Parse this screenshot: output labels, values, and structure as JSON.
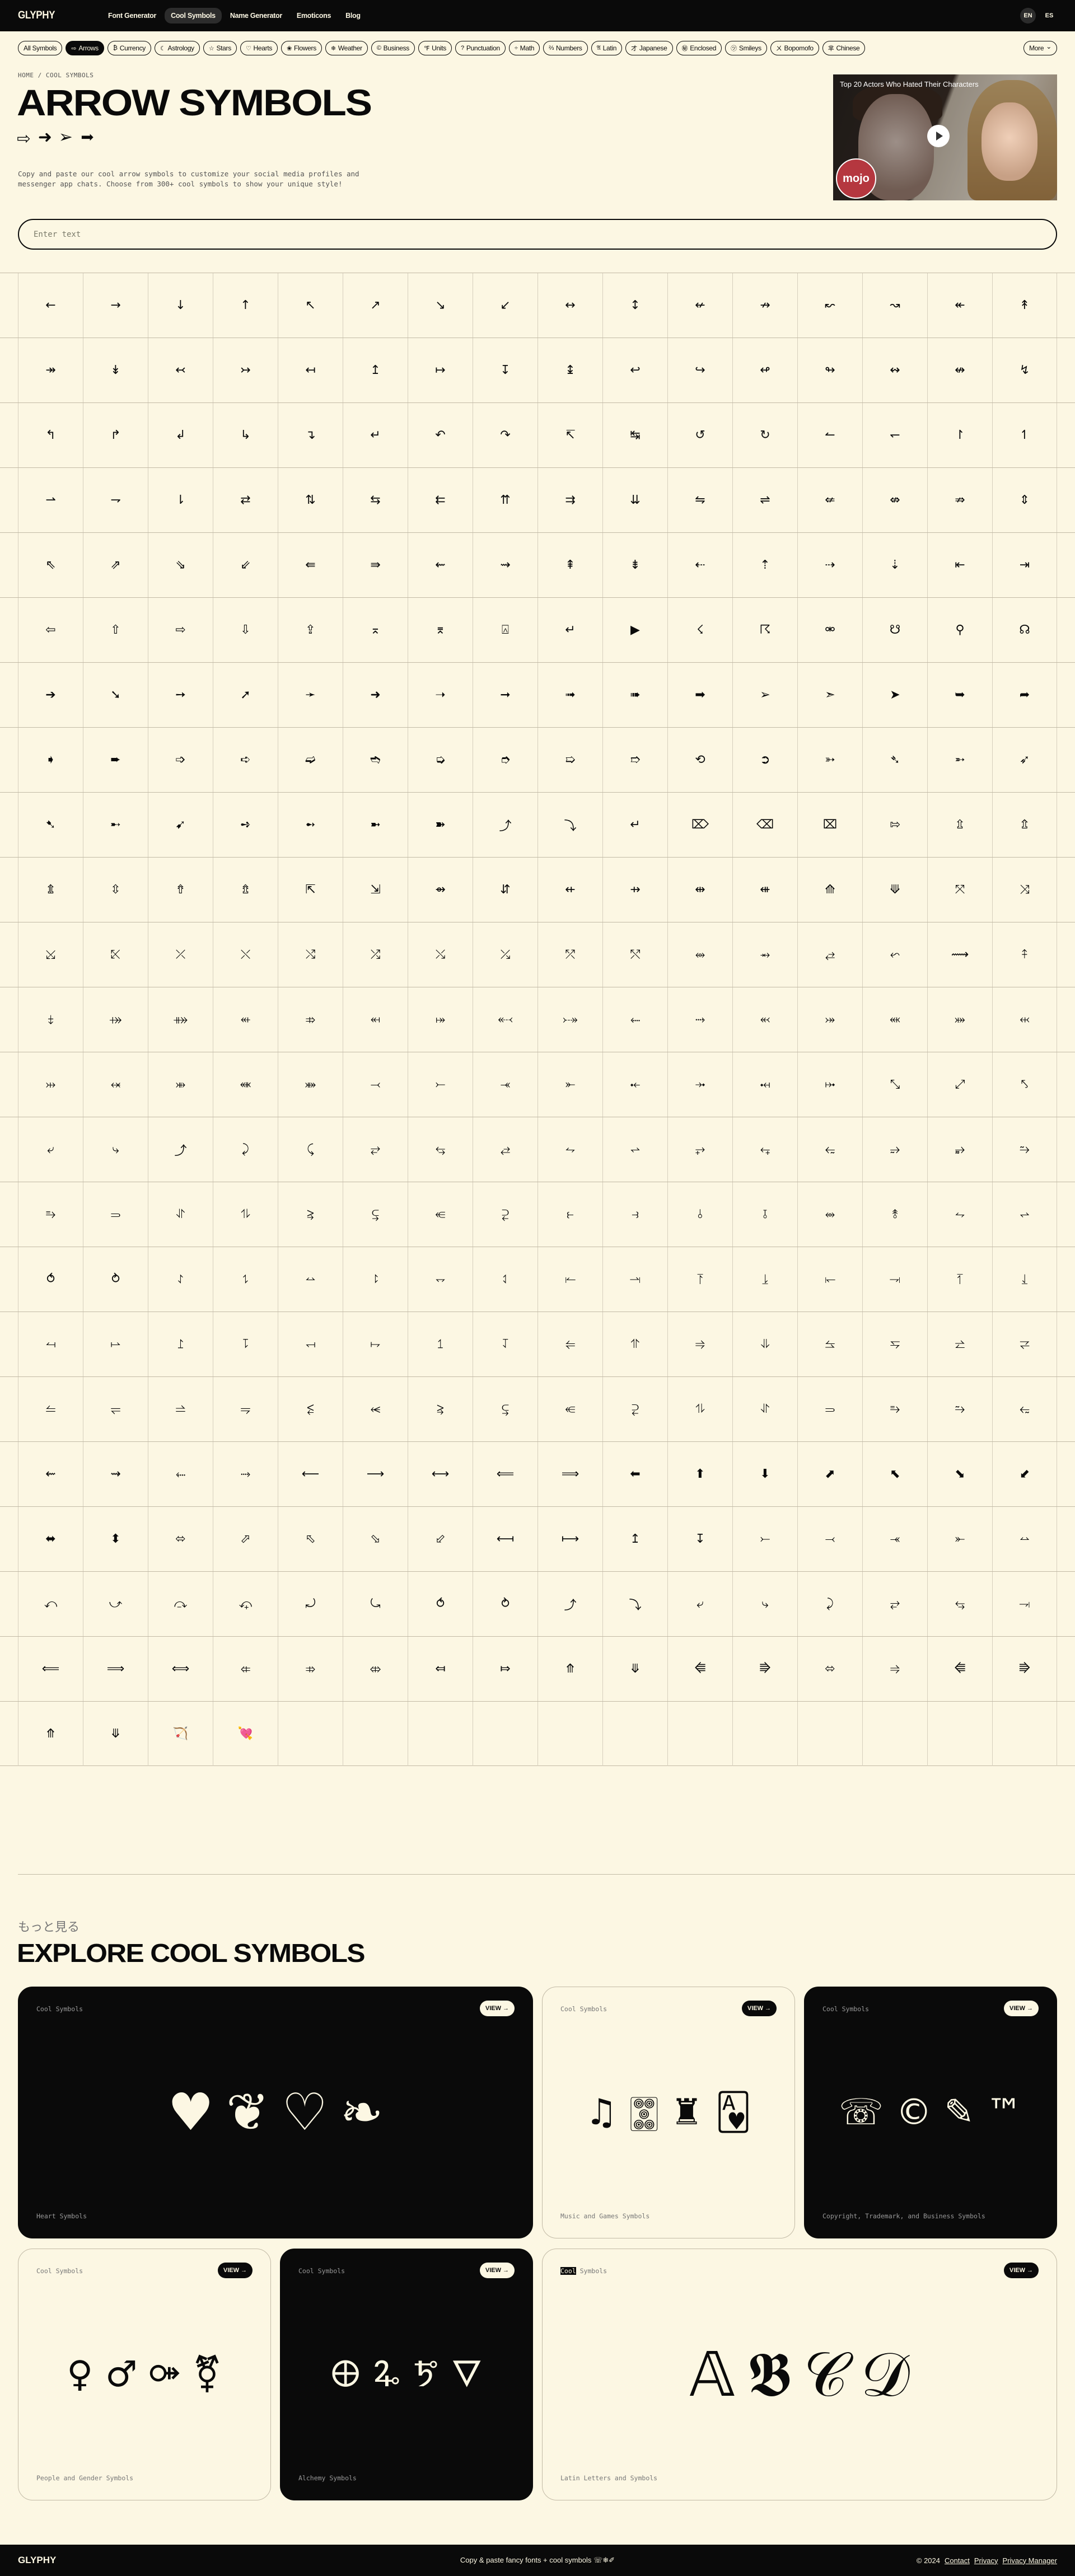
{
  "nav": {
    "logo": "GLYPHY",
    "links": [
      {
        "label": "Font Generator",
        "active": false
      },
      {
        "label": "Cool Symbols",
        "active": true
      },
      {
        "label": "Name Generator",
        "active": false
      },
      {
        "label": "Emoticons",
        "active": false
      },
      {
        "label": "Blog",
        "active": false
      }
    ],
    "languages": [
      {
        "label": "EN",
        "active": true
      },
      {
        "label": "ES",
        "active": false
      }
    ]
  },
  "categories": [
    {
      "icon": "",
      "label": "All Symbols",
      "active": false
    },
    {
      "icon": "⇨",
      "label": "Arrows",
      "active": true
    },
    {
      "icon": "₿",
      "label": "Currency",
      "active": false
    },
    {
      "icon": "☾",
      "label": "Astrology",
      "active": false
    },
    {
      "icon": "☆",
      "label": "Stars",
      "active": false
    },
    {
      "icon": "♡",
      "label": "Hearts",
      "active": false
    },
    {
      "icon": "❀",
      "label": "Flowers",
      "active": false
    },
    {
      "icon": "❄",
      "label": "Weather",
      "active": false
    },
    {
      "icon": "©",
      "label": "Business",
      "active": false
    },
    {
      "icon": "℉",
      "label": "Units",
      "active": false
    },
    {
      "icon": "?",
      "label": "Punctuation",
      "active": false
    },
    {
      "icon": "÷",
      "label": "Math",
      "active": false
    },
    {
      "icon": "⅔",
      "label": "Numbers",
      "active": false
    },
    {
      "icon": "𝔄",
      "label": "Latin",
      "active": false
    },
    {
      "icon": "才",
      "label": "Japanese",
      "active": false
    },
    {
      "icon": "㊙",
      "label": "Enclosed",
      "active": false
    },
    {
      "icon": "㋡",
      "label": "Smileys",
      "active": false
    },
    {
      "icon": "ㄨ",
      "label": "Bopomofo",
      "active": false
    },
    {
      "icon": "芈",
      "label": "Chinese",
      "active": false
    }
  ],
  "more_label": "More",
  "breadcrumb": {
    "home": "HOME",
    "sep": " / ",
    "current": "COOL SYMBOLS"
  },
  "page_title": "ARROW SYMBOLS",
  "hero_symbols": [
    "⇨",
    "➜",
    "➢",
    "➡"
  ],
  "description": "Copy and paste our cool arrow symbols to customize your social media profiles and messenger app chats. Choose from 300+ cool symbols to show your unique style!",
  "ad": {
    "title": "Top 20 Actors Who Hated Their Characters",
    "badge": "mojo"
  },
  "search": {
    "placeholder": "Enter text",
    "value": ""
  },
  "symbols": [
    "←",
    "→",
    "↓",
    "↑",
    "↖",
    "↗",
    "↘",
    "↙",
    "↔",
    "↕",
    "↚",
    "↛",
    "↜",
    "↝",
    "↞",
    "↟",
    "↠",
    "↡",
    "↢",
    "↣",
    "↤",
    "↥",
    "↦",
    "↧",
    "↨",
    "↩",
    "↪",
    "↫",
    "↬",
    "↭",
    "↮",
    "↯",
    "↰",
    "↱",
    "↲",
    "↳",
    "↴",
    "↵",
    "↶",
    "↷",
    "↸",
    "↹",
    "↺",
    "↻",
    "↼",
    "↽",
    "↾",
    "↿",
    "⇀",
    "⇁",
    "⇂",
    "⇄",
    "⇅",
    "⇆",
    "⇇",
    "⇈",
    "⇉",
    "⇊",
    "⇋",
    "⇌",
    "⇍",
    "⇎",
    "⇏",
    "⇕",
    "⇖",
    "⇗",
    "⇘",
    "⇙",
    "⇚",
    "⇛",
    "⇜",
    "⇝",
    "⇞",
    "⇟",
    "⇠",
    "⇡",
    "⇢",
    "⇣",
    "⇤",
    "⇥",
    "⇦",
    "⇧",
    "⇨",
    "⇩",
    "⇪",
    "⌅",
    "⌆",
    "⍓",
    "↵",
    "▶",
    "☇",
    "☈",
    "⚮",
    "☋",
    "⚲",
    "☊",
    "➔",
    "➘",
    "➙",
    "➚",
    "➛",
    "➜",
    "➝",
    "➞",
    "➟",
    "➠",
    "➡",
    "➢",
    "➣",
    "➤",
    "➥",
    "➦",
    "➧",
    "➨",
    "➩",
    "➪",
    "➫",
    "➬",
    "➭",
    "➮",
    "➯",
    "➱",
    "⟲",
    "➲",
    "➳",
    "➴",
    "➵",
    "➶",
    "➷",
    "➸",
    "➹",
    "➺",
    "➻",
    "➼",
    "➽",
    "⤴",
    "⤵",
    "↵",
    "⌦",
    "⌫",
    "⌧",
    "⇰",
    "⇫",
    "⇬",
    "⇭",
    "⇳",
    "⇮",
    "⇯",
    "⇱",
    "⇲",
    "⇴",
    "⇵",
    "⇷",
    "⇸",
    "⇹",
    "⇺",
    "⟰",
    "⟱",
    "⤧",
    "⤨",
    "⤩",
    "⤪",
    "⤫",
    "⤬",
    "⤭",
    "⤮",
    "⤯",
    "⤰",
    "⤱",
    "⤲",
    "⥈",
    "⥇",
    "⥄",
    "⬿",
    "⟿",
    "⤉",
    "⤈",
    "⤀",
    "⤁",
    "⬴",
    "⤃",
    "⬶",
    "⤅",
    "⬷",
    "⤐",
    "⬸",
    "⤑",
    "⬻",
    "⤖",
    "⬼",
    "⤗",
    "⬹",
    "⤔",
    "⬾",
    "⤕",
    "⬽",
    "⤘",
    "⤙",
    "⤚",
    "⤛",
    "⤜",
    "⤝",
    "⤞",
    "⤟",
    "⤠",
    "⤡",
    "⤢",
    "⤣",
    "⤶",
    "⤷",
    "⤴",
    "⤸",
    "⤹",
    "⥂",
    "⥃",
    "⥄",
    "⥊",
    "⥋",
    "⥅",
    "⥆",
    "⥳",
    "⥴",
    "⥵",
    "⥲",
    "⥱",
    "⥰",
    "⥯",
    "⥮",
    "⥸",
    "⥹",
    "⥺",
    "⥻",
    "⥼",
    "⥽",
    "⫰",
    "⫱",
    "⥈",
    "⥉",
    "⥊",
    "⥋",
    "⥀",
    "⥁",
    "⥌",
    "⥍",
    "⥎",
    "⥏",
    "⥐",
    "⥑",
    "⥒",
    "⥓",
    "⥔",
    "⥕",
    "⥖",
    "⥗",
    "⥘",
    "⥙",
    "⥚",
    "⥛",
    "⥜",
    "⥝",
    "⥞",
    "⥟",
    "⥠",
    "⥡",
    "⥢",
    "⥣",
    "⥤",
    "⥥",
    "⥦",
    "⥧",
    "⥨",
    "⥩",
    "⥪",
    "⥫",
    "⥬",
    "⥭",
    "⥶",
    "⥷",
    "⥸",
    "⥹",
    "⥺",
    "⥻",
    "⥮",
    "⥯",
    "⥰",
    "⥱",
    "⥲",
    "⥳",
    "⇜",
    "⇝",
    "⬸",
    "⤑",
    "⟵",
    "⟶",
    "⟷",
    "⟸",
    "⟹",
    "⬅",
    "⬆",
    "⬇",
    "⬈",
    "⬉",
    "⬊",
    "⬋",
    "⬌",
    "⬍",
    "⬄",
    "⬀",
    "⬁",
    "⬂",
    "⬃",
    "⟻",
    "⟼",
    "↥",
    "↧",
    "⤚",
    "⤙",
    "⤛",
    "⤜",
    "⥎",
    "⤺",
    "⤻",
    "⤼",
    "⤽",
    "⤾",
    "⤿",
    "⥀",
    "⥁",
    "⤴",
    "⤵",
    "⤶",
    "⤷",
    "⤸",
    "⥂",
    "⥃",
    "⥗",
    "⟸",
    "⟹",
    "⟺",
    "⤂",
    "⤃",
    "⤄",
    "⤆",
    "⤇",
    "⤊",
    "⤋",
    "⭅",
    "⭆",
    "⬄",
    "⥤",
    "⭅",
    "⭆",
    "⤊",
    "⤋",
    "🏹",
    "💘"
  ],
  "explore": {
    "kicker": "もっと見る",
    "title": "EXPLORE COOL SYMBOLS",
    "cards": [
      {
        "tag": "Cool Symbols",
        "view": "VIEW",
        "name": "Heart Symbols",
        "symbols": [
          "♥",
          "❦",
          "♡",
          "❧"
        ],
        "dark": true
      },
      {
        "tag": "Cool Symbols",
        "view": "VIEW",
        "name": "Music and Games Symbols",
        "symbols": [
          "♫",
          "🀝",
          "♜",
          "🂱"
        ],
        "dark": false
      },
      {
        "tag": "Cool Symbols",
        "view": "VIEW",
        "name": "Copyright, Trademark, and Business Symbols",
        "symbols": [
          "☏",
          "©",
          "✎",
          "™"
        ],
        "dark": true
      },
      {
        "tag": "Cool Symbols",
        "view": "VIEW",
        "name": "People and Gender Symbols",
        "symbols": [
          "♀",
          "♂",
          "⚩",
          "⚧"
        ],
        "dark": false
      },
      {
        "tag": "Cool Symbols",
        "view": "VIEW",
        "name": "Alchemy Symbols",
        "symbols": [
          "🜨",
          "🜩",
          "🜪",
          "🜄"
        ],
        "dark": true
      },
      {
        "tag": "Cool Symbols",
        "tag_highlight": "Cool",
        "tag_rest": " Symbols",
        "view": "VIEW",
        "name": "Latin Letters and Symbols",
        "symbols": [
          "𝔸",
          "𝕭",
          "𝒞",
          "𝒟"
        ],
        "dark": false
      }
    ]
  },
  "footer": {
    "logo": "GLYPHY",
    "tagline": "Copy & paste fancy fonts + cool symbols ☏❄✐",
    "copyright": "© 2024",
    "links": [
      "Contact",
      "Privacy",
      "Privacy Manager"
    ]
  }
}
